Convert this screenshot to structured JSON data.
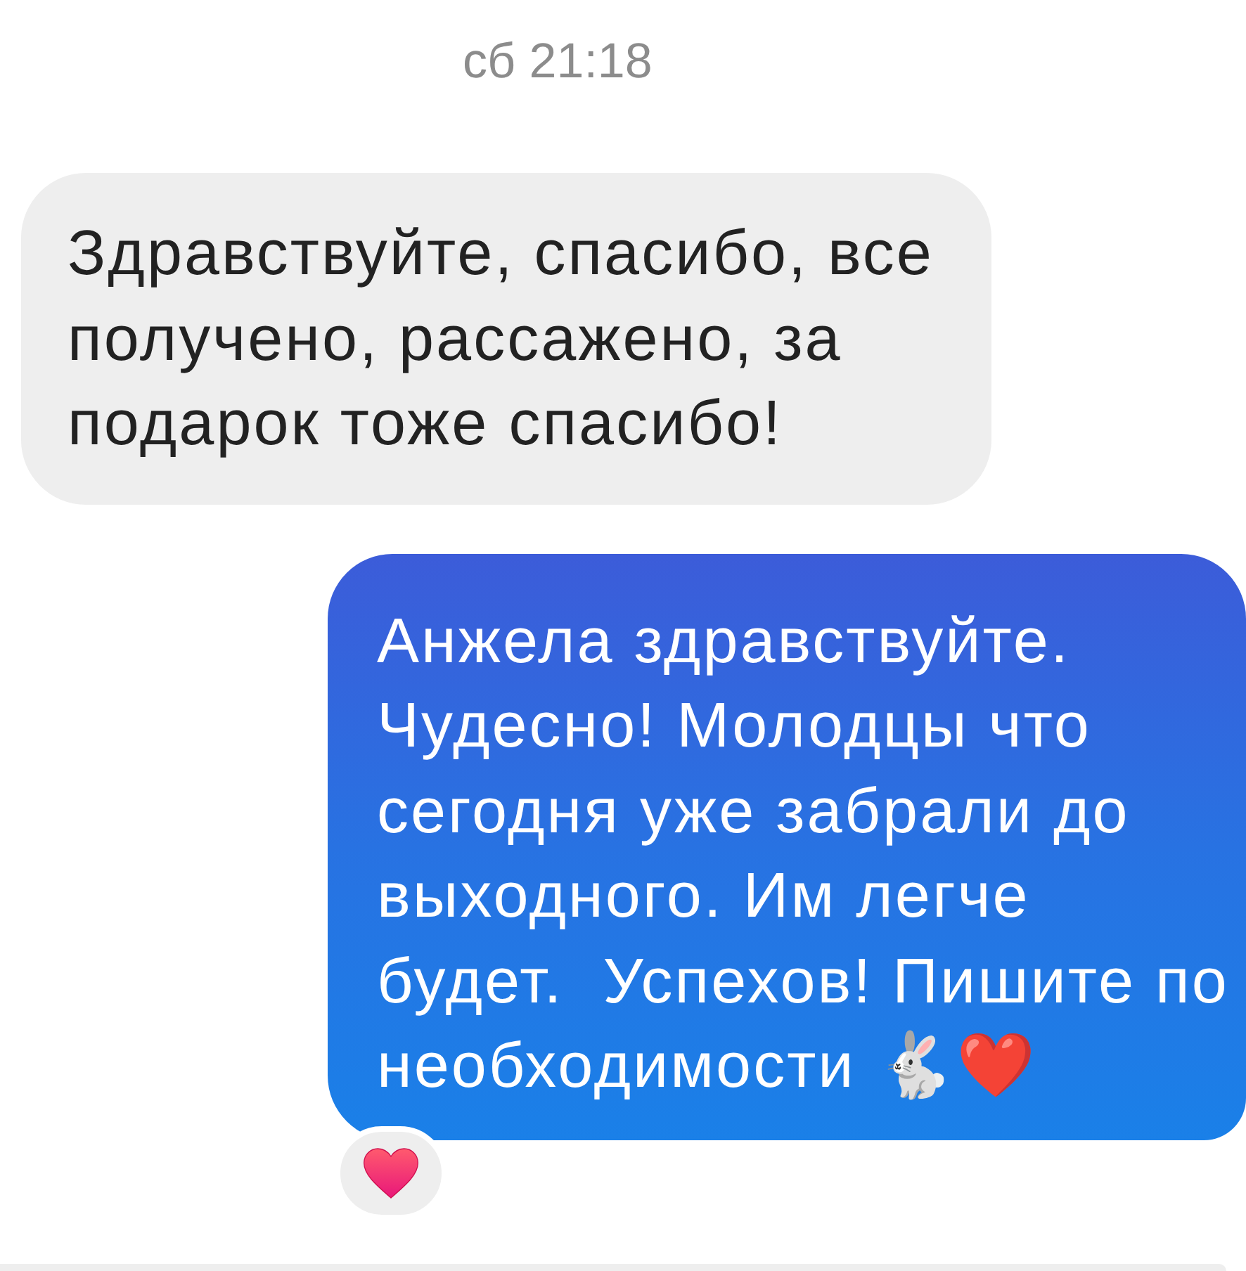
{
  "timestamp": "сб 21:18",
  "messages": [
    {
      "kind": "incoming",
      "text": "Здравствуйте, спасибо, все получено, рассажено, за подарок тоже спасибо!",
      "reacted": false
    },
    {
      "kind": "outgoing",
      "text": "Анжела здравствуйте. Чудесно! Молодцы что сегодня уже забрали до выходного. Им легче будет.  Успехов! Пишите по необходимости 🐇❤️",
      "reacted": true
    }
  ]
}
